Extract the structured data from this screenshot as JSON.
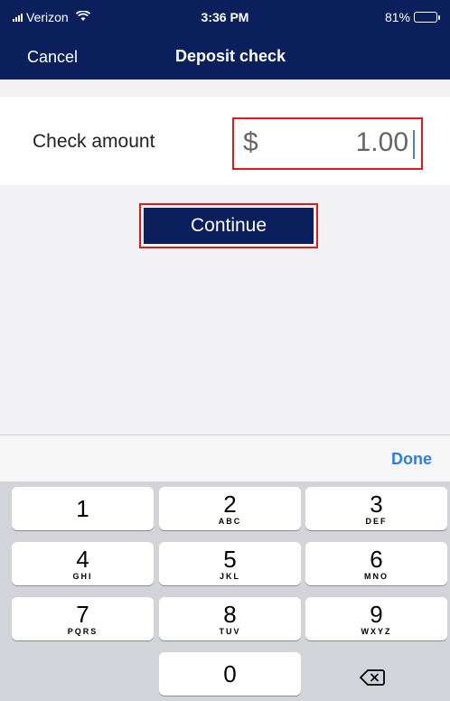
{
  "status_bar": {
    "carrier": "Verizon",
    "time": "3:36 PM",
    "battery_percent": "81%",
    "battery_level": 0.81
  },
  "nav": {
    "cancel": "Cancel",
    "title": "Deposit check"
  },
  "amount": {
    "label": "Check amount",
    "currency": "$",
    "value": "1.00"
  },
  "continue_label": "Continue",
  "keyboard": {
    "done": "Done",
    "keys": [
      {
        "digit": "1",
        "letters": ""
      },
      {
        "digit": "2",
        "letters": "ABC"
      },
      {
        "digit": "3",
        "letters": "DEF"
      },
      {
        "digit": "4",
        "letters": "GHI"
      },
      {
        "digit": "5",
        "letters": "JKL"
      },
      {
        "digit": "6",
        "letters": "MNO"
      },
      {
        "digit": "7",
        "letters": "PQRS"
      },
      {
        "digit": "8",
        "letters": "TUV"
      },
      {
        "digit": "9",
        "letters": "WXYZ"
      },
      {
        "digit": "0",
        "letters": ""
      }
    ]
  },
  "icons": {
    "wifi": "wifi-icon",
    "signal": "signal-icon",
    "battery": "battery-icon",
    "delete": "backspace-icon"
  },
  "colors": {
    "header_bg": "#0a1f5c",
    "highlight": "#e01a1a",
    "done": "#2f7de1",
    "battery": "#2fd158"
  }
}
